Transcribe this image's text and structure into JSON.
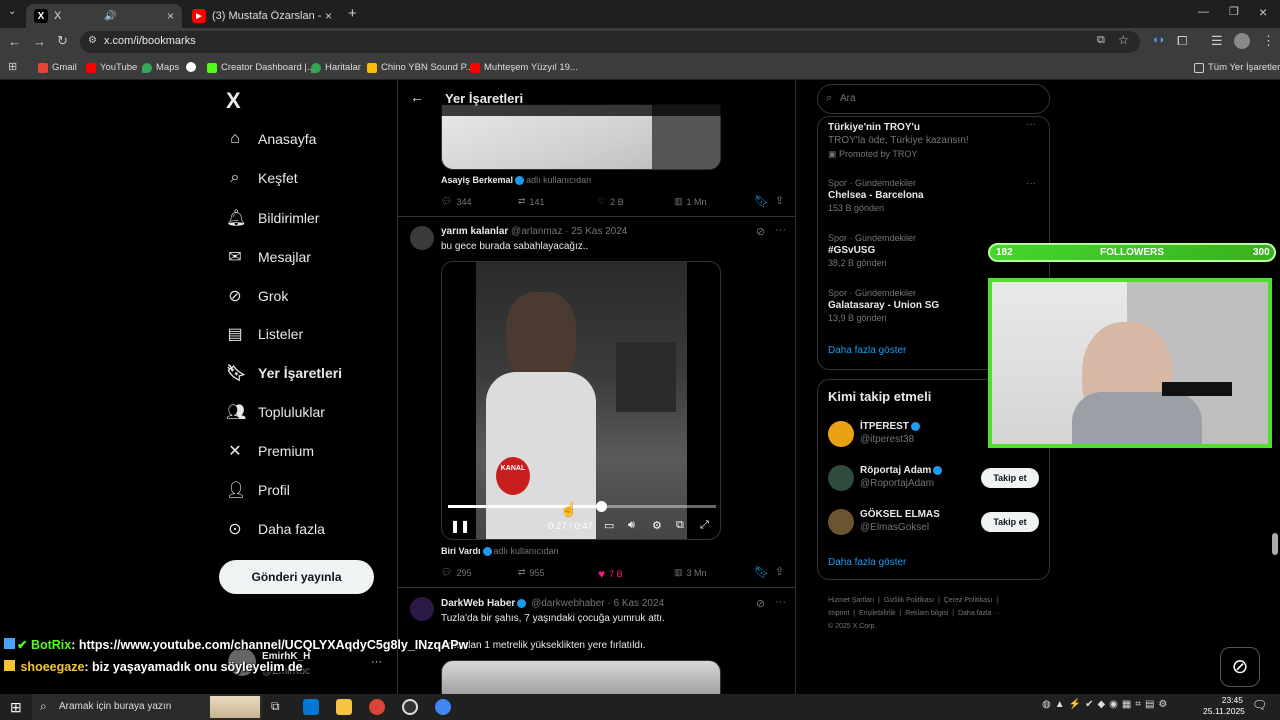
{
  "browser": {
    "tabs": [
      {
        "label": "X",
        "favicon": "X"
      },
      {
        "label": "(3) Mustafa Özarslan - Arayı Ara"
      }
    ],
    "new_tab": "+",
    "url": "x.com/i/bookmarks",
    "bookmarks": [
      "Gmail",
      "YouTube",
      "Maps",
      "Creator Dashboard |...",
      "Haritalar",
      "Chino YBN Sound P...",
      "Muhteşem Yüzyıl 19..."
    ],
    "all_bookmarks": "Tüm Yer İşaretleri"
  },
  "nav": {
    "logo": "X",
    "items": [
      "Anasayfa",
      "Keşfet",
      "Bildirimler",
      "Mesajlar",
      "Grok",
      "Listeler",
      "Yer İşaretleri",
      "Topluluklar",
      "Premium",
      "Profil",
      "Daha fazla"
    ],
    "post_button": "Gönderi yayınla",
    "profile_name": "EmirhK_H",
    "profile_handle": "@EmirKoc",
    "more": "···"
  },
  "main": {
    "title": "Yer İşaretleri",
    "tweet1": {
      "source": "Asayiş Berkemal",
      "source_suffix": "adlı kullanıcıdan",
      "replies": "344",
      "retweets": "141",
      "likes": "2 B",
      "views": "1 Mn"
    },
    "tweet2": {
      "name": "yarım kalanlar",
      "handle": "@arlanmaz · 25 Kas 2024",
      "text": "bu gece burada sabahlayacağız..",
      "video_time": "0:27 / 0:47",
      "video_progress": 0.57,
      "video_label": "KANAL",
      "source": "Biri Vardı",
      "source_suffix": "adlı kullanıcıdan",
      "replies": "295",
      "retweets": "955",
      "likes": "7 B",
      "views": "3 Mn"
    },
    "tweet3": {
      "name": "DarkWeb Haber",
      "handle": "@darkwebhaber · 6 Kas 2024",
      "text1": "Tuzla'da bir şahıs, 7 yaşındaki çocuğa yumruk attı.",
      "text2": "Ardından 1 metrelik yükseklikten yere fırlatıldı."
    }
  },
  "right": {
    "search_placeholder": "Ara",
    "promo": {
      "title": "Türkiye'nin TROY'u",
      "sub": "TROY'la öde, Türkiye kazansın!",
      "promoted": "Promoted by TROY"
    },
    "trends": [
      {
        "cat": "Spor · Gündemdekiler",
        "title": "Chelsea - Barcelona",
        "count": "153 B gönderi"
      },
      {
        "cat": "Spor · Gündemdekiler",
        "title": "#GSvUSG",
        "count": "38,2 B gönderi"
      },
      {
        "cat": "Spor · Gündemdekiler",
        "title": "Galatasaray - Union SG",
        "count": "13,9 B gönderi"
      }
    ],
    "show_more": "Daha fazla göster",
    "who_to_follow": "Kimi takip etmeli",
    "suggestions": [
      {
        "name": "İTPEREST",
        "handle": "@itperest38"
      },
      {
        "name": "Röportaj Adam",
        "handle": "@RoportajAdam",
        "button": "Takip et"
      },
      {
        "name": "GÖKSEL ELMAS",
        "handle": "@ElmasGoksel",
        "button": "Takip et"
      }
    ],
    "show_more2": "Daha fazla göster",
    "footer": [
      "Hizmet Şartları",
      "Gizlilik Politikası",
      "Çerez Politikası",
      "Imprint",
      "Erişilebilirlik",
      "Reklam bilgisi",
      "Daha fazla ···",
      "© 2025 X Corp."
    ]
  },
  "overlay": {
    "followers_min": "182",
    "followers_label": "FOLLOWERS",
    "followers_max": "300",
    "chat": [
      {
        "user": "BotRix",
        "text": ": https://www.youtube.com/channel/UCQLYXAqdyC5g8ly_INzqAPw"
      },
      {
        "user": "shoeegaze",
        "text": ": biz yaşayamadık onu söyleyelim de"
      }
    ]
  },
  "taskbar": {
    "search_placeholder": "Aramak için buraya yazın",
    "time": "23:45",
    "date": "25.11.2025"
  },
  "colors": {
    "accent": "#1d9bf0",
    "like": "#f91880",
    "overlay_green": "#44d62c"
  }
}
